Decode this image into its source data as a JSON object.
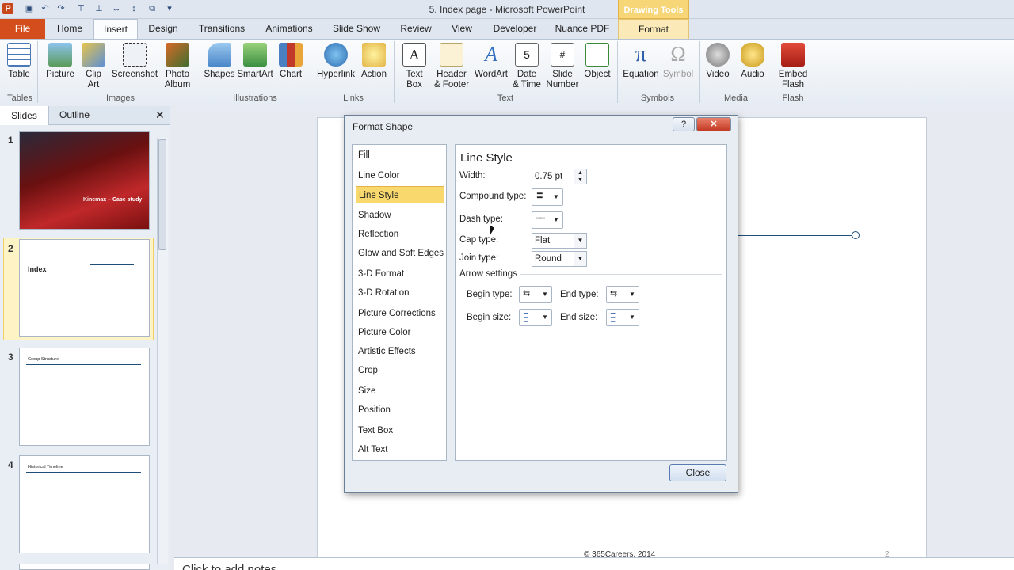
{
  "title": "5. Index page - Microsoft PowerPoint",
  "contextual_tab": "Drawing Tools",
  "tabs": [
    "File",
    "Home",
    "Insert",
    "Design",
    "Transitions",
    "Animations",
    "Slide Show",
    "Review",
    "View",
    "Developer",
    "Nuance PDF",
    "Format"
  ],
  "ribbon": {
    "buttons": [
      {
        "label": "Table",
        "icon": "table-icon"
      },
      {
        "label": "Picture",
        "icon": "picture-icon"
      },
      {
        "label": "Clip\nArt",
        "icon": "clip-art-icon"
      },
      {
        "label": "Screenshot",
        "icon": "screenshot-icon"
      },
      {
        "label": "Photo\nAlbum",
        "icon": "photo-album-icon"
      },
      {
        "label": "Shapes",
        "icon": "shapes-icon"
      },
      {
        "label": "SmartArt",
        "icon": "smartart-icon"
      },
      {
        "label": "Chart",
        "icon": "chart-icon"
      },
      {
        "label": "Hyperlink",
        "icon": "hyperlink-icon"
      },
      {
        "label": "Action",
        "icon": "action-icon"
      },
      {
        "label": "Text\nBox",
        "icon": "text-box-icon"
      },
      {
        "label": "Header\n& Footer",
        "icon": "header-footer-icon"
      },
      {
        "label": "WordArt",
        "icon": "wordart-icon"
      },
      {
        "label": "Date\n& Time",
        "icon": "date-time-icon"
      },
      {
        "label": "Slide\nNumber",
        "icon": "slide-number-icon"
      },
      {
        "label": "Object",
        "icon": "object-icon"
      },
      {
        "label": "Equation",
        "icon": "equation-icon"
      },
      {
        "label": "Symbol",
        "icon": "symbol-icon"
      },
      {
        "label": "Video",
        "icon": "video-icon"
      },
      {
        "label": "Audio",
        "icon": "audio-icon"
      },
      {
        "label": "Embed\nFlash",
        "icon": "embed-flash-icon"
      }
    ],
    "groups": [
      "Tables",
      "Images",
      "Illustrations",
      "Links",
      "Text",
      "Symbols",
      "Media",
      "Flash"
    ]
  },
  "left_panel": {
    "tabs": [
      "Slides",
      "Outline"
    ],
    "slides": [
      {
        "num": "1",
        "title": "Kinemax – Case study"
      },
      {
        "num": "2",
        "title": "Index"
      },
      {
        "num": "3",
        "title": "Group Structure"
      },
      {
        "num": "4",
        "title": "Historical Timeline"
      }
    ]
  },
  "slide": {
    "footer": "© 365Careers, 2014",
    "page_number": "2",
    "notes_placeholder": "Click to add notes"
  },
  "dialog": {
    "title": "Format Shape",
    "help": "?",
    "categories": [
      "Fill",
      "Line Color",
      "Line Style",
      "Shadow",
      "Reflection",
      "Glow and Soft Edges",
      "3-D Format",
      "3-D Rotation",
      "Picture Corrections",
      "Picture Color",
      "Artistic Effects",
      "Crop",
      "Size",
      "Position",
      "Text Box",
      "Alt Text"
    ],
    "selected_category": "Line Style",
    "heading": "Line Style",
    "width_label": "Width:",
    "width_value": "0.75 pt",
    "compound_label": "Compound type:",
    "dash_label": "Dash type:",
    "cap_label": "Cap type:",
    "cap_value": "Flat",
    "join_label": "Join type:",
    "join_value": "Round",
    "arrow_heading": "Arrow settings",
    "begin_type_label": "Begin type:",
    "end_type_label": "End type:",
    "begin_size_label": "Begin size:",
    "end_size_label": "End size:",
    "close_label": "Close"
  }
}
